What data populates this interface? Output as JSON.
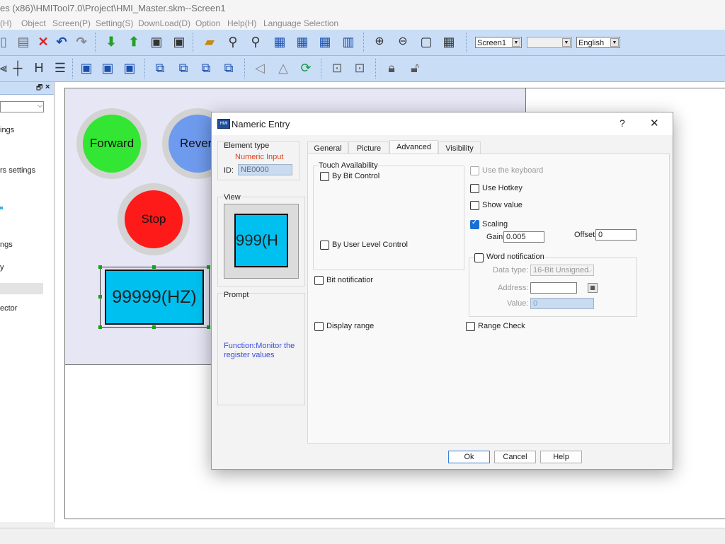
{
  "window": {
    "title": "es (x86)\\HMITool7.0\\Project\\HMI_Master.skm--Screen1"
  },
  "menu": [
    "(H)",
    "Object",
    "Screen(P)",
    "Setting(S)",
    "DownLoad(D)",
    "Option",
    "Help(H)",
    "Language Selection"
  ],
  "toolbar": {
    "screen_combo": "Screen1",
    "language_combo": "English"
  },
  "left_panel": {
    "items": [
      "ings",
      "rs settings",
      "ngs",
      "y",
      "ector"
    ]
  },
  "canvas": {
    "forward_label": "Forward",
    "reverse_label": "Rever",
    "stop_label": "Stop",
    "numeric_display": "99999(HZ)",
    "colors": {
      "forward": "#33e633",
      "reverse": "#6f9bef",
      "stop": "#ff1a1a",
      "numeric": "#00c0f0"
    }
  },
  "dialog": {
    "title": "Nameric Entry",
    "help_glyph": "?",
    "close_glyph": "✕",
    "app_icon": "HMI",
    "element_type_label": "Element type",
    "element_type_value": "Numeric Input",
    "id_label": "ID:",
    "id_value": "NE0000",
    "view_label": "View",
    "view_preview": "999(H",
    "prompt_label": "Prompt",
    "prompt_text": "Function:Monitor the register values",
    "tabs": [
      "General",
      "Picture",
      "Advanced",
      "Visibility"
    ],
    "active_tab": "Advanced",
    "touch_availability": "Touch Availability",
    "by_bit_control": "By Bit Control",
    "by_user_level_control": "By User Level Control",
    "bit_notification": "Bit notificatior",
    "display_range": "Display range",
    "use_keyboard": "Use the keyboard",
    "use_hotkey": "Use Hotkey",
    "show_value": "Show value",
    "scaling": "Scaling",
    "gain_label": "Gain:",
    "gain_value": "0.005",
    "offset_label": "Offset:",
    "offset_value": "0",
    "word_notification": "Word notification",
    "data_type_label": "Data type:",
    "data_type_value": "16-Bit Unsigned",
    "address_label": "Address:",
    "address_value": "",
    "value_label": "Value:",
    "value_value": "0",
    "range_check": "Range Check",
    "ok": "Ok",
    "cancel": "Cancel",
    "help": "Help"
  }
}
